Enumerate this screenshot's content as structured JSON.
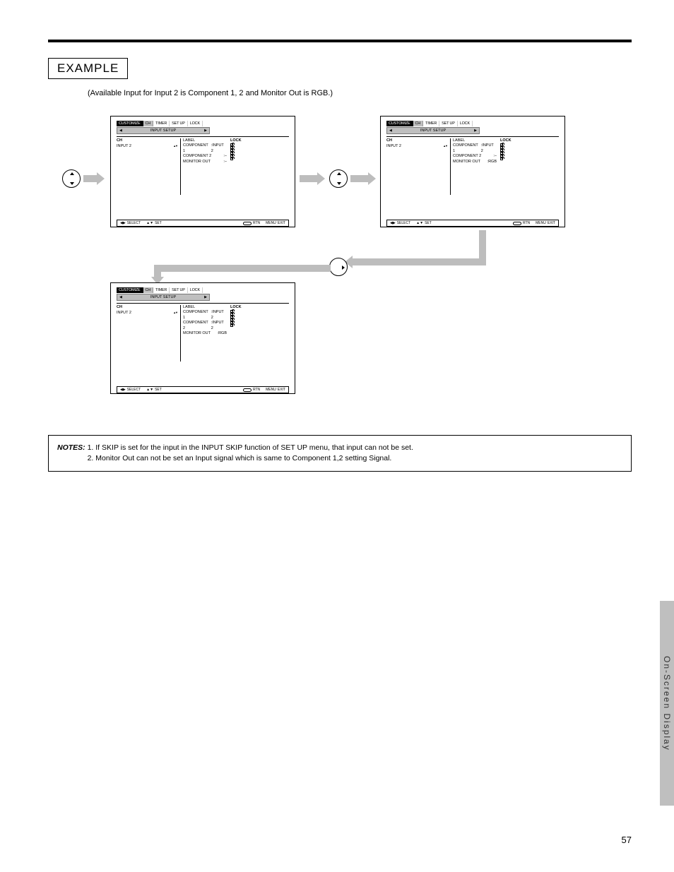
{
  "header": {
    "example_label": "EXAMPLE",
    "example_desc": "(Available Input for Input 2 is Component 1, 2 and Monitor Out is RGB.)"
  },
  "osd_common": {
    "tabs": [
      "CUSTOMIZE",
      "CH",
      "TIMER",
      "SET UP",
      "LOCK"
    ],
    "subtab_label": "INPUT SETUP",
    "columns": {
      "ch_header": "CH",
      "label_header": "LABEL",
      "lock_header": "LOCK"
    },
    "help": {
      "select": "SELECT",
      "set": "SET",
      "rtn": "RTN",
      "menu": "MENU",
      "exit": "EXIT"
    }
  },
  "screens": [
    {
      "rows": {
        "current": "INPUT 2",
        "labels": [
          [
            "COMPONENT 1",
            ":INPUT 2"
          ],
          [
            "COMPONENT 2",
            ":–"
          ],
          [
            "MONITOR OUT",
            ":–"
          ]
        ],
        "locks": 6
      }
    },
    {
      "rows": {
        "current": "INPUT 2",
        "labels": [
          [
            "COMPONENT 1",
            ":INPUT 2"
          ],
          [
            "COMPONENT 2",
            ":–"
          ],
          [
            "MONITOR OUT",
            ":RGB"
          ]
        ],
        "locks": 6
      }
    },
    {
      "rows": {
        "current": "INPUT 2",
        "labels": [
          [
            "COMPONENT 1",
            ":INPUT 2"
          ],
          [
            "COMPONENT 2",
            ":INPUT 2"
          ],
          [
            "MONITOR OUT",
            ":RGB"
          ]
        ],
        "locks": 6
      }
    }
  ],
  "notes": {
    "lead": "NOTES:",
    "line1": "1. If SKIP is set for the input in the INPUT SKIP function of SET UP menu, that input can not be set.",
    "line2": "2. Monitor Out can not be set an Input signal which is same to Component 1,2 setting Signal."
  },
  "sidebar": "On-Screen Display",
  "page_number": "57"
}
